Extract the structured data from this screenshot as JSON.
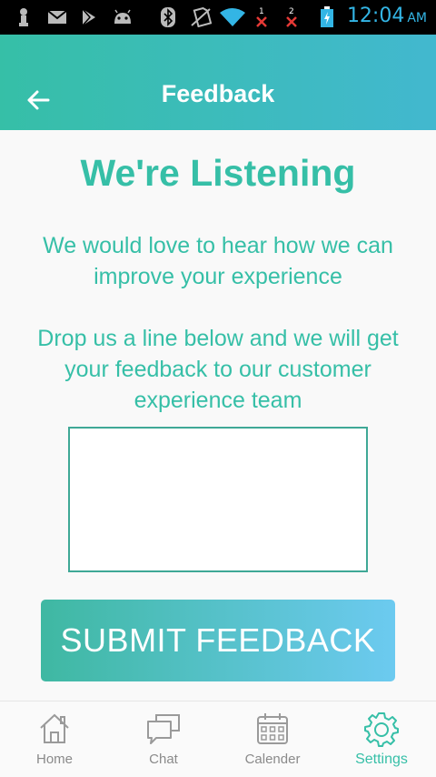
{
  "status_bar": {
    "time": "12:04",
    "ampm": "AM",
    "icons": [
      "usb-icon",
      "gmail-icon",
      "play-store-icon",
      "android-debug-icon",
      "bluetooth-icon",
      "no-sim-icon",
      "wifi-icon",
      "sim1-no-signal-icon",
      "sim2-no-signal-icon",
      "battery-charging-icon"
    ],
    "sim1_label": "1",
    "sim2_label": "2"
  },
  "header": {
    "title": "Feedback",
    "back_icon": "arrow-left-icon"
  },
  "main": {
    "headline": "We're Listening",
    "intro": "We would love to hear how we can improve your experience",
    "intro2": "Drop us a line below and we will get your feedback to our customer experience team",
    "feedback_value": "",
    "submit_label": "SUBMIT FEEDBACK"
  },
  "bottom_nav": {
    "items": [
      {
        "label": "Home",
        "icon": "home-icon"
      },
      {
        "label": "Chat",
        "icon": "chat-icon"
      },
      {
        "label": "Calender",
        "icon": "calendar-icon"
      },
      {
        "label": "Settings",
        "icon": "gear-icon"
      }
    ],
    "active": "Settings"
  },
  "colors": {
    "accent": "#36bfa7",
    "header_start": "#36bfa7",
    "header_end": "#42b8cf",
    "button_start": "#3fb8a2",
    "button_end": "#6ccaf0",
    "status_time": "#33b5e5",
    "inactive_nav": "#8a8a8a"
  }
}
